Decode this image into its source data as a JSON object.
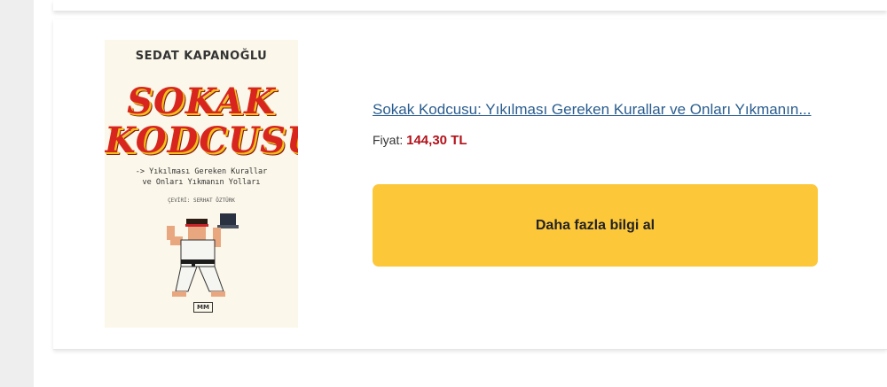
{
  "product": {
    "title": "Sokak Kodcusu: Yıkılması Gereken Kurallar ve Onları Yıkmanın...",
    "price_label": "Fiyat:",
    "price_value": "144,30 TL",
    "cta_label": "Daha fazla bilgi al"
  },
  "cover": {
    "author": "SEDAT KAPANOĞLU",
    "title_line1": "SOKAK",
    "title_line2": "KODCUSU",
    "subtitle_line1": "-> Yıkılması Gereken Kurallar",
    "subtitle_line2": "ve Onları Yıkmanın Yolları",
    "translator": "ÇEVİRİ: SERHAT ÖZTÜRK",
    "publisher": "MM"
  },
  "colors": {
    "cta_background": "#fdc73a",
    "link": "#2a5d8f",
    "price": "#b3121a"
  }
}
